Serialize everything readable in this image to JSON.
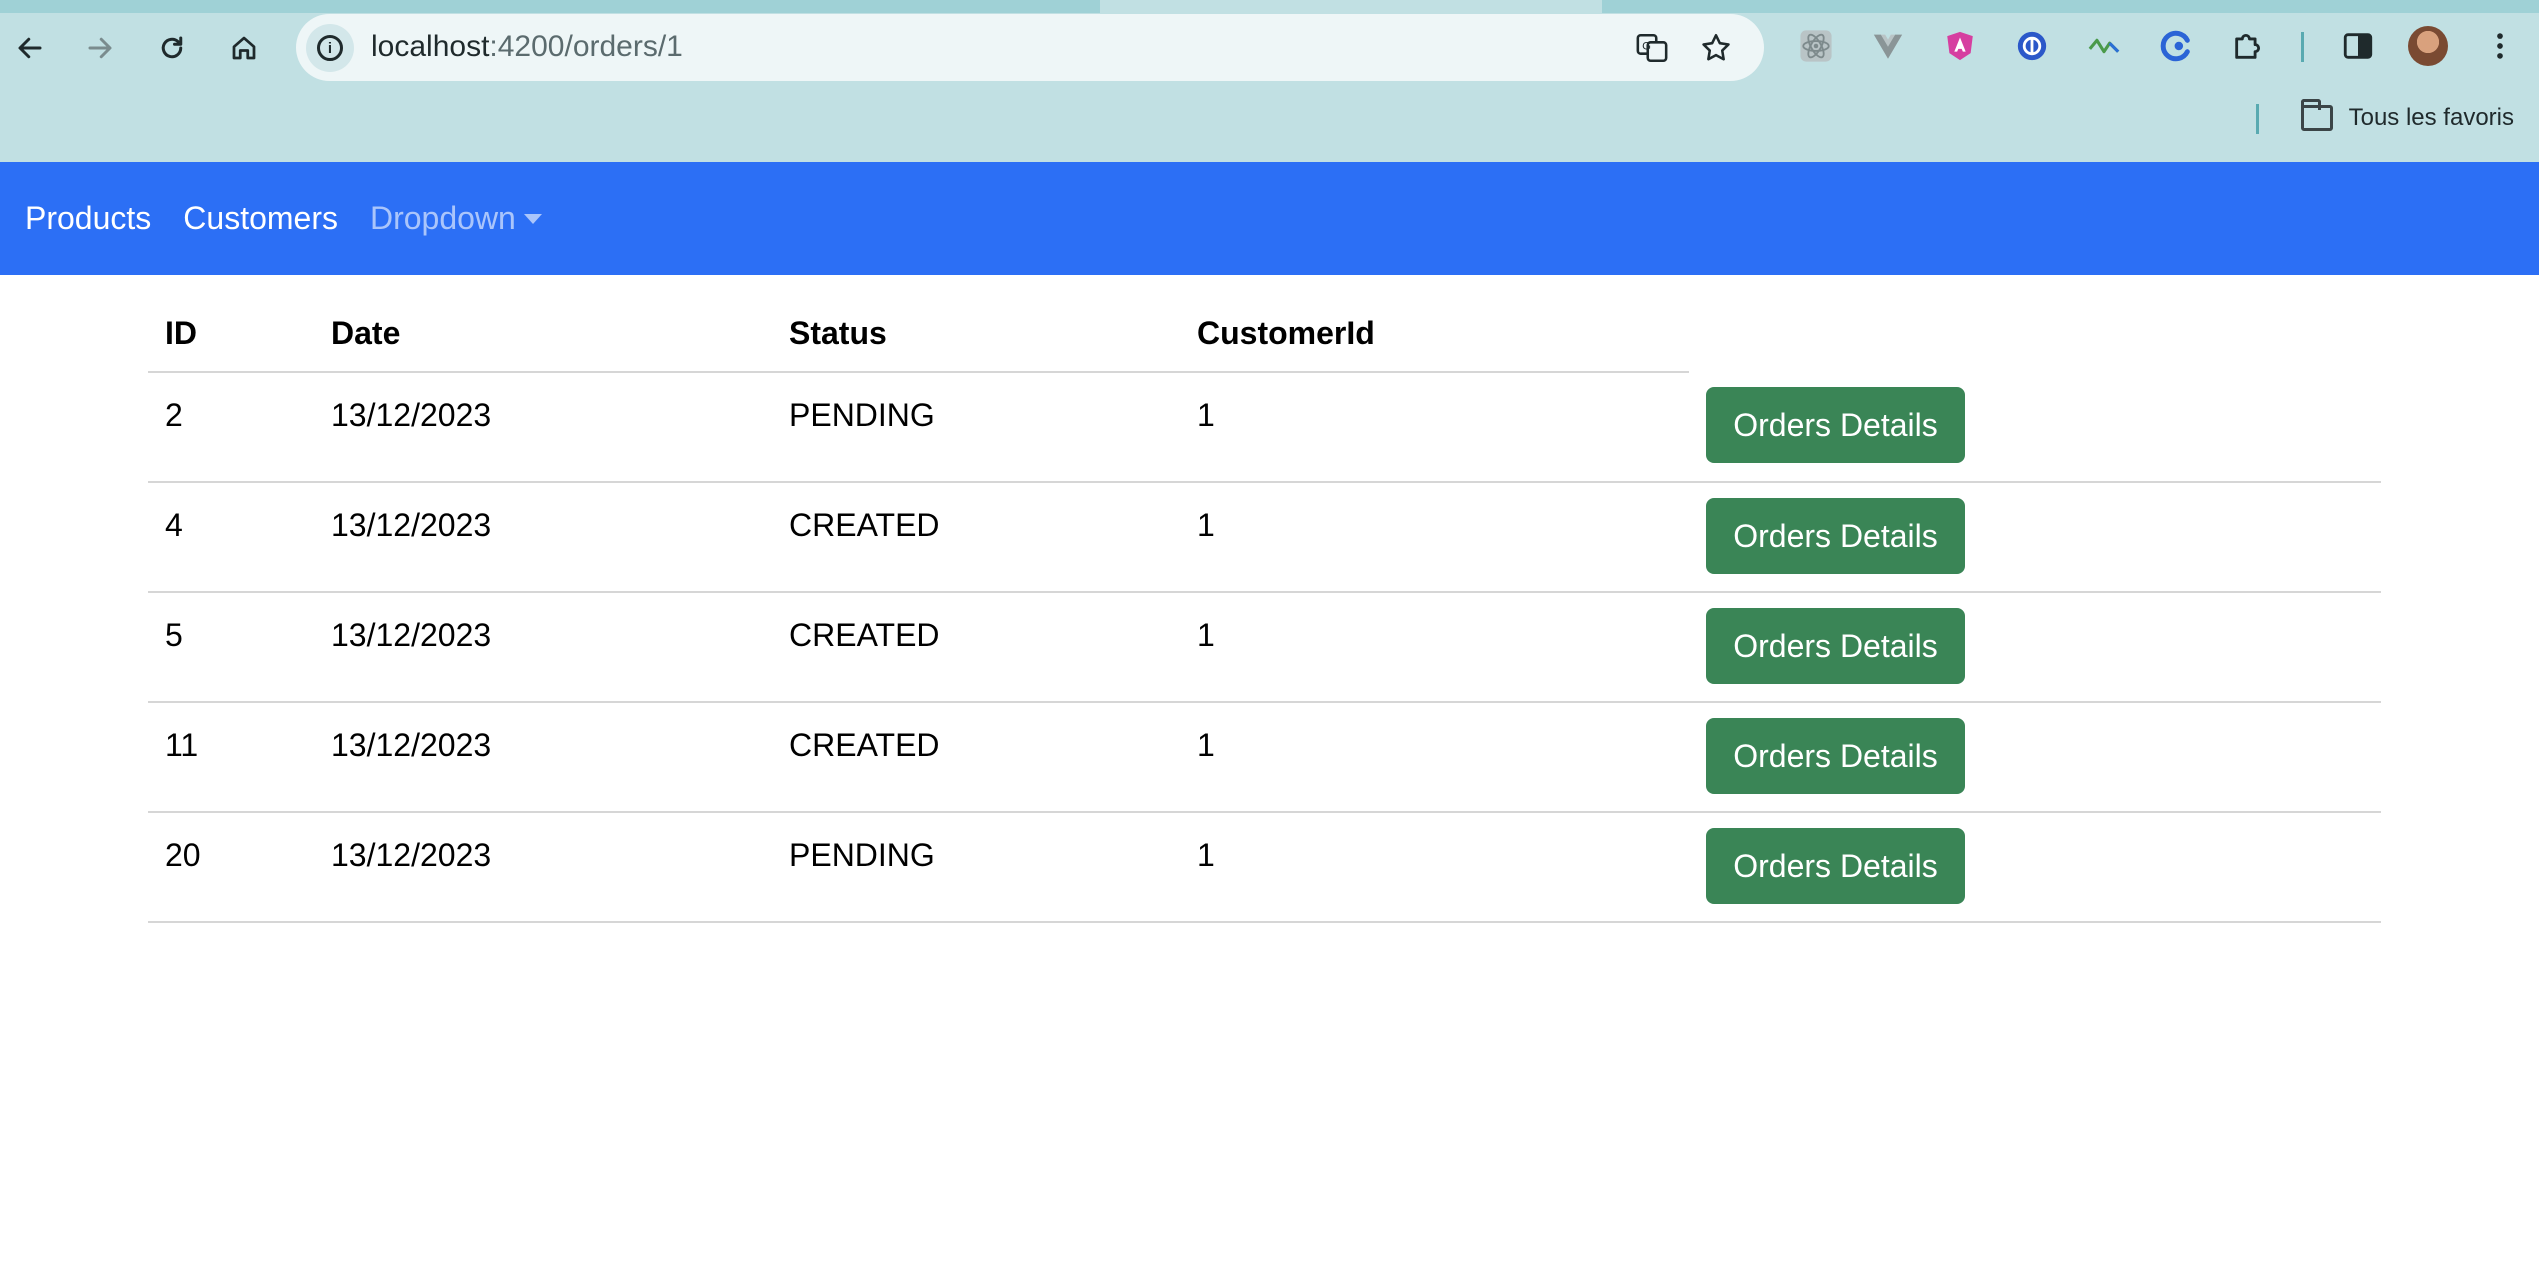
{
  "browser": {
    "url_host": "localhost",
    "url_rest": ":4200/orders/1",
    "bookmarks_label": "Tous les favoris",
    "icons": {
      "back": "arrow-left-icon",
      "forward": "arrow-right-icon",
      "reload": "reload-icon",
      "home": "home-icon",
      "site_info": "info-icon",
      "translate": "translate-icon",
      "bookmark": "star-icon",
      "extensions": [
        "react-devtools-icon",
        "vue-devtools-icon",
        "angular-devtools-icon",
        "extension-icon",
        "extension-icon",
        "extension-icon"
      ],
      "puzzle": "puzzle-icon",
      "side_panel": "side-panel-icon",
      "menu": "kebab-menu-icon"
    }
  },
  "navbar": {
    "color": "#2c6ff5",
    "links": [
      "Products",
      "Customers"
    ],
    "dropdown_label": "Dropdown"
  },
  "table": {
    "headers": [
      "ID",
      "Date",
      "Status",
      "CustomerId"
    ],
    "rows": [
      {
        "id": "2",
        "date": "13/12/2023",
        "status": "PENDING",
        "customer_id": "1"
      },
      {
        "id": "4",
        "date": "13/12/2023",
        "status": "CREATED",
        "customer_id": "1"
      },
      {
        "id": "5",
        "date": "13/12/2023",
        "status": "CREATED",
        "customer_id": "1"
      },
      {
        "id": "11",
        "date": "13/12/2023",
        "status": "CREATED",
        "customer_id": "1"
      },
      {
        "id": "20",
        "date": "13/12/2023",
        "status": "PENDING",
        "customer_id": "1"
      }
    ],
    "action_label": "Orders Details",
    "action_color": "#3a8556"
  }
}
